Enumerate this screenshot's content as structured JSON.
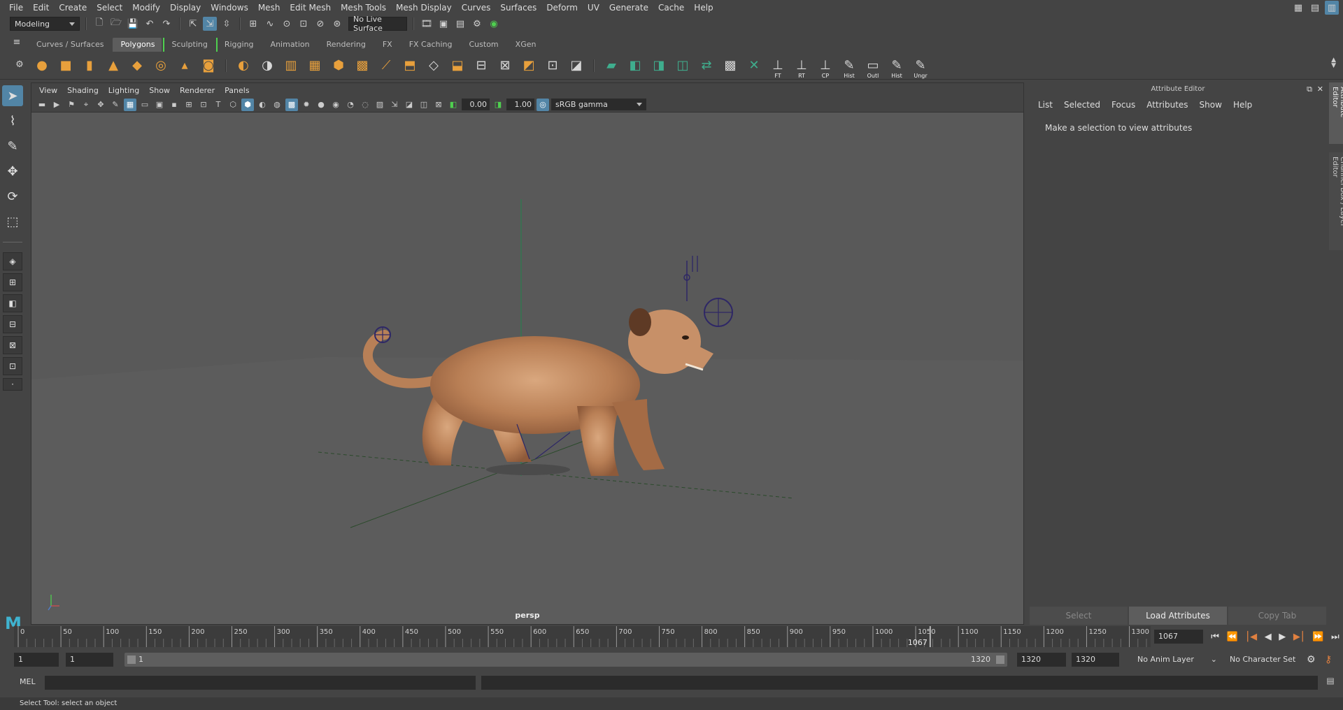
{
  "menubar": {
    "items": [
      "File",
      "Edit",
      "Create",
      "Select",
      "Modify",
      "Display",
      "Windows",
      "Mesh",
      "Edit Mesh",
      "Mesh Tools",
      "Mesh Display",
      "Curves",
      "Surfaces",
      "Deform",
      "UV",
      "Generate",
      "Cache",
      "Help"
    ]
  },
  "statusline": {
    "menuset": "Modeling",
    "live_surface": "No Live Surface"
  },
  "shelf": {
    "tabs": [
      "Curves / Surfaces",
      "Polygons",
      "Sculpting",
      "Rigging",
      "Animation",
      "Rendering",
      "FX",
      "FX Caching",
      "Custom",
      "XGen"
    ],
    "active_tab": "Polygons",
    "icon_labels": {
      "ft": "FT",
      "rt": "RT",
      "cp": "CP",
      "hist": "Hist",
      "outl": "Outl",
      "hist2": "Hist",
      "ungr": "Ungr"
    }
  },
  "viewport": {
    "menu": [
      "View",
      "Shading",
      "Lighting",
      "Show",
      "Renderer",
      "Panels"
    ],
    "exposure": "0.00",
    "gamma": "1.00",
    "color_space": "sRGB gamma",
    "camera": "persp"
  },
  "attribute_editor": {
    "title": "Attribute Editor",
    "menu": [
      "List",
      "Selected",
      "Focus",
      "Attributes",
      "Show",
      "Help"
    ],
    "hint": "Make a selection to view attributes",
    "buttons": {
      "select": "Select",
      "load": "Load Attributes",
      "copy": "Copy Tab"
    }
  },
  "side_tabs": {
    "attribute_editor": "Attribute Editor",
    "channel_box": "Channel Box / Layer Editor"
  },
  "timeline": {
    "ticks": [
      "0",
      "50",
      "100",
      "150",
      "200",
      "250",
      "300",
      "350",
      "400",
      "450",
      "500",
      "550",
      "600",
      "650",
      "700",
      "750",
      "800",
      "850",
      "900",
      "950",
      "1000",
      "1050",
      "1100",
      "1150",
      "1200",
      "1250",
      "1300"
    ],
    "range_min": 0,
    "range_max": 1320,
    "current_frame": "1067",
    "current_frame_field": "1067"
  },
  "range": {
    "start": "1",
    "playback_start": "1",
    "slider_start": "1",
    "slider_end": "1320",
    "playback_end": "1320",
    "end": "1320",
    "anim_layer": "No Anim Layer",
    "character_set": "No Character Set"
  },
  "cmdline": {
    "label": "MEL"
  },
  "helpline": {
    "text": "Select Tool: select an object"
  }
}
